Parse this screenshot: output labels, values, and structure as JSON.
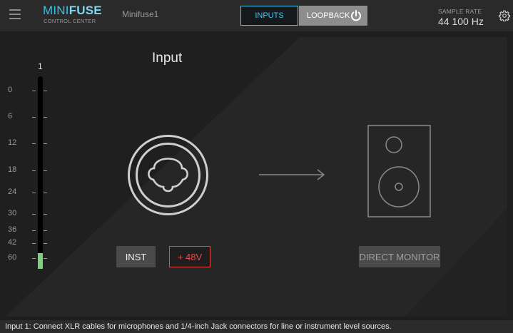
{
  "topbar": {
    "menu_icon": "hamburger-menu-icon",
    "logo_mini": "MINI",
    "logo_fuse": "FUSE",
    "logo_sub": "CONTROL CENTER",
    "device_name": "Minifuse1",
    "tabs": [
      {
        "label": "INPUTS",
        "active": true
      },
      {
        "label": "LOOPBACK",
        "active": false
      }
    ],
    "loopback_icon": "power-icon",
    "sample_rate_label": "SAMPLE RATE",
    "sample_rate_value": "44 100 Hz",
    "settings_icon": "gear-icon"
  },
  "input_panel": {
    "channel_number": "1",
    "meter_scale": [
      "0",
      "6",
      "12",
      "18",
      "24",
      "30",
      "36",
      "42",
      "60"
    ],
    "meter_level_fraction": 0.08,
    "title": "Input",
    "xlr_icon": "xlr-combo-jack-icon",
    "arrow_icon": "arrow-right-icon",
    "speaker_icon": "speaker-monitor-icon",
    "inst_label": "INST",
    "phantom_label": "+ 48V",
    "direct_monitor_label": "DIRECT MONITOR"
  },
  "status_bar": {
    "text": "Input 1: Connect XLR cables for microphones and 1/4-inch Jack connectors for line or instrument level sources."
  },
  "colors": {
    "accent": "#3ec7ef",
    "meter_green": "#7ed081",
    "phantom_red": "#e84b4b",
    "background": "#1e1e1e",
    "panel": "#262626"
  }
}
